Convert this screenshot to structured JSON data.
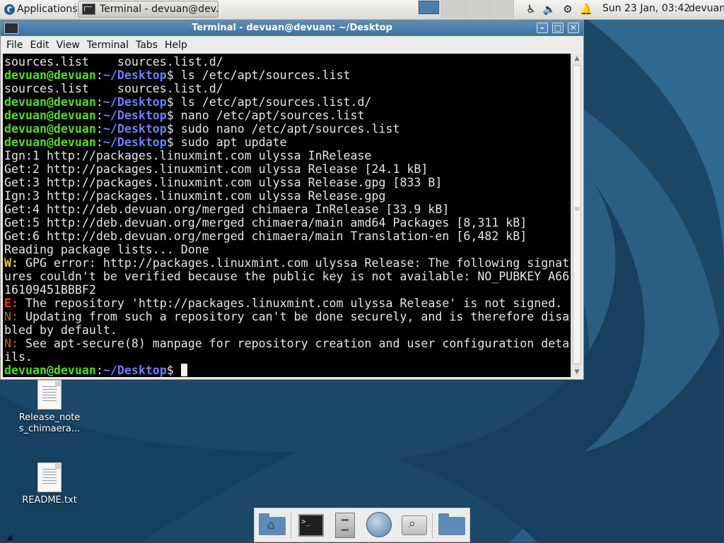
{
  "panel": {
    "apps_label": "Applications",
    "task_label": "Terminal - devuan@dev...",
    "clock": "Sun 23 Jan, 03:42",
    "user": "devuan"
  },
  "window": {
    "title": "Terminal - devuan@devuan: ~/Desktop",
    "min_symbol": "–",
    "max_symbol": "□",
    "close_symbol": "✕"
  },
  "menu": {
    "items": [
      "File",
      "Edit",
      "View",
      "Terminal",
      "Tabs",
      "Help"
    ]
  },
  "terminal": {
    "user_host": "devuan@devuan",
    "path": "~/Desktop",
    "lines": [
      {
        "kind": "out",
        "text": "sources.list    sources.list.d/"
      },
      {
        "kind": "cmd",
        "text": "ls /etc/apt/sources.list"
      },
      {
        "kind": "out",
        "text": "sources.list    sources.list.d/"
      },
      {
        "kind": "cmd",
        "text": "ls /etc/apt/sources.list.d/"
      },
      {
        "kind": "cmd",
        "text": "nano /etc/apt/sources.list"
      },
      {
        "kind": "cmd",
        "text": "sudo nano /etc/apt/sources.list"
      },
      {
        "kind": "cmd",
        "text": "sudo apt update"
      },
      {
        "kind": "out",
        "text": "Ign:1 http://packages.linuxmint.com ulyssa InRelease"
      },
      {
        "kind": "out",
        "text": "Get:2 http://packages.linuxmint.com ulyssa Release [24.1 kB]"
      },
      {
        "kind": "out",
        "text": "Get:3 http://packages.linuxmint.com ulyssa Release.gpg [833 B]"
      },
      {
        "kind": "out",
        "text": "Ign:3 http://packages.linuxmint.com ulyssa Release.gpg"
      },
      {
        "kind": "out",
        "text": "Get:4 http://deb.devuan.org/merged chimaera InRelease [33.9 kB]"
      },
      {
        "kind": "out",
        "text": "Get:5 http://deb.devuan.org/merged chimaera/main amd64 Packages [8,311 kB]"
      },
      {
        "kind": "out",
        "text": "Get:6 http://deb.devuan.org/merged chimaera/main Translation-en [6,482 kB]"
      },
      {
        "kind": "out",
        "text": "Reading package lists... Done"
      },
      {
        "kind": "warn",
        "tag": "W:",
        "text": " GPG error: http://packages.linuxmint.com ulyssa Release: The following signat"
      },
      {
        "kind": "out",
        "text": "ures couldn't be verified because the public key is not available: NO_PUBKEY A66"
      },
      {
        "kind": "out",
        "text": "16109451BBBF2"
      },
      {
        "kind": "err",
        "tag": "E:",
        "text": " The repository 'http://packages.linuxmint.com ulyssa Release' is not signed."
      },
      {
        "kind": "note",
        "tag": "N:",
        "text": " Updating from such a repository can't be done securely, and is therefore disa"
      },
      {
        "kind": "out",
        "text": "bled by default."
      },
      {
        "kind": "note",
        "tag": "N:",
        "text": " See apt-secure(8) manpage for repository creation and user configuration deta"
      },
      {
        "kind": "out",
        "text": "ils."
      },
      {
        "kind": "prompt",
        "text": ""
      }
    ]
  },
  "desktop_icons": [
    {
      "label": "Release_note\ns_chimaera..."
    },
    {
      "label": "README.txt"
    }
  ],
  "dock": {
    "items": [
      "home-folder",
      "terminal",
      "file-cabinet",
      "web-browser",
      "search",
      "files-folder"
    ]
  },
  "colors": {
    "prompt_user": "#59d82c",
    "prompt_path": "#6f7ff5",
    "warn": "#e8d32c",
    "error": "#ee3232",
    "note": "#b5672a",
    "titlebar": "#4a7aa8"
  }
}
